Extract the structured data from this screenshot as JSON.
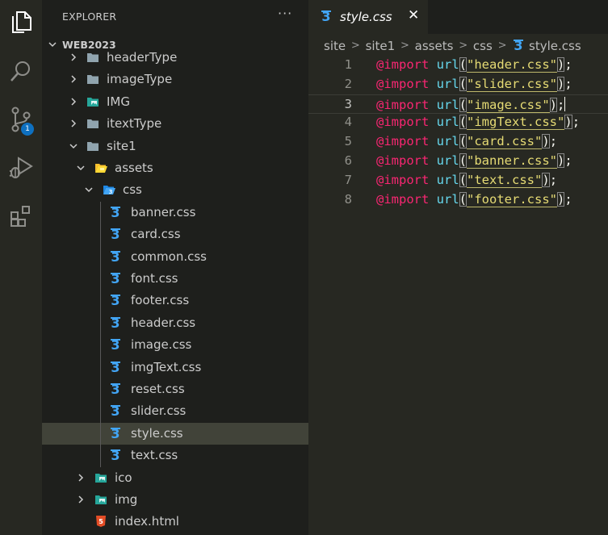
{
  "sidebar": {
    "title": "EXPLORER",
    "more": "···",
    "root": "WEB2023",
    "items": [
      {
        "label": "headerType",
        "depth": 1,
        "kind": "folder",
        "expanded": false
      },
      {
        "label": "imageType",
        "depth": 1,
        "kind": "folder",
        "expanded": false
      },
      {
        "label": "IMG",
        "depth": 1,
        "kind": "folder-image",
        "expanded": false
      },
      {
        "label": "itextType",
        "depth": 1,
        "kind": "folder",
        "expanded": false
      },
      {
        "label": "site1",
        "depth": 1,
        "kind": "folder",
        "expanded": true
      },
      {
        "label": "assets",
        "depth": 2,
        "kind": "folder-open-assets",
        "expanded": true
      },
      {
        "label": "css",
        "depth": 3,
        "kind": "folder-open-css",
        "expanded": true
      },
      {
        "label": "banner.css",
        "depth": 4,
        "kind": "css-file"
      },
      {
        "label": "card.css",
        "depth": 4,
        "kind": "css-file"
      },
      {
        "label": "common.css",
        "depth": 4,
        "kind": "css-file"
      },
      {
        "label": "font.css",
        "depth": 4,
        "kind": "css-file"
      },
      {
        "label": "footer.css",
        "depth": 4,
        "kind": "css-file"
      },
      {
        "label": "header.css",
        "depth": 4,
        "kind": "css-file"
      },
      {
        "label": "image.css",
        "depth": 4,
        "kind": "css-file"
      },
      {
        "label": "imgText.css",
        "depth": 4,
        "kind": "css-file"
      },
      {
        "label": "reset.css",
        "depth": 4,
        "kind": "css-file"
      },
      {
        "label": "slider.css",
        "depth": 4,
        "kind": "css-file"
      },
      {
        "label": "style.css",
        "depth": 4,
        "kind": "css-file",
        "selected": true
      },
      {
        "label": "text.css",
        "depth": 4,
        "kind": "css-file"
      },
      {
        "label": "ico",
        "depth": 2,
        "kind": "folder-image",
        "expanded": false
      },
      {
        "label": "img",
        "depth": 2,
        "kind": "folder-image",
        "expanded": false
      },
      {
        "label": "index.html",
        "depth": 2,
        "kind": "html-file"
      }
    ]
  },
  "activity": {
    "items": [
      "files-icon",
      "search-icon",
      "source-control-icon",
      "run-debug-icon",
      "extensions-icon"
    ],
    "badge": "1"
  },
  "editor": {
    "tab": {
      "label": "style.css",
      "close": "✕"
    },
    "breadcrumb": [
      "site",
      "site1",
      "assets",
      "css",
      "style.css"
    ],
    "current_line": 3,
    "lines": [
      {
        "n": "1",
        "file": "header.css"
      },
      {
        "n": "2",
        "file": "slider.css"
      },
      {
        "n": "3",
        "file": "image.css"
      },
      {
        "n": "4",
        "file": "imgText.css"
      },
      {
        "n": "5",
        "file": "card.css"
      },
      {
        "n": "6",
        "file": "banner.css"
      },
      {
        "n": "7",
        "file": "text.css"
      },
      {
        "n": "8",
        "file": "footer.css"
      }
    ],
    "tokens": {
      "at": "@import",
      "fn": "url",
      "open": "(",
      "close": ")",
      "semi": ";",
      "quote": "\""
    }
  },
  "colors": {
    "keyword": "#f92672",
    "function": "#66d9ef",
    "string": "#e6db74",
    "css_icon": "#42a5f5",
    "html_icon": "#e44d26",
    "folder": "#90a4ae",
    "image_folder": "#26a69a",
    "assets_folder": "#fbc02d"
  }
}
